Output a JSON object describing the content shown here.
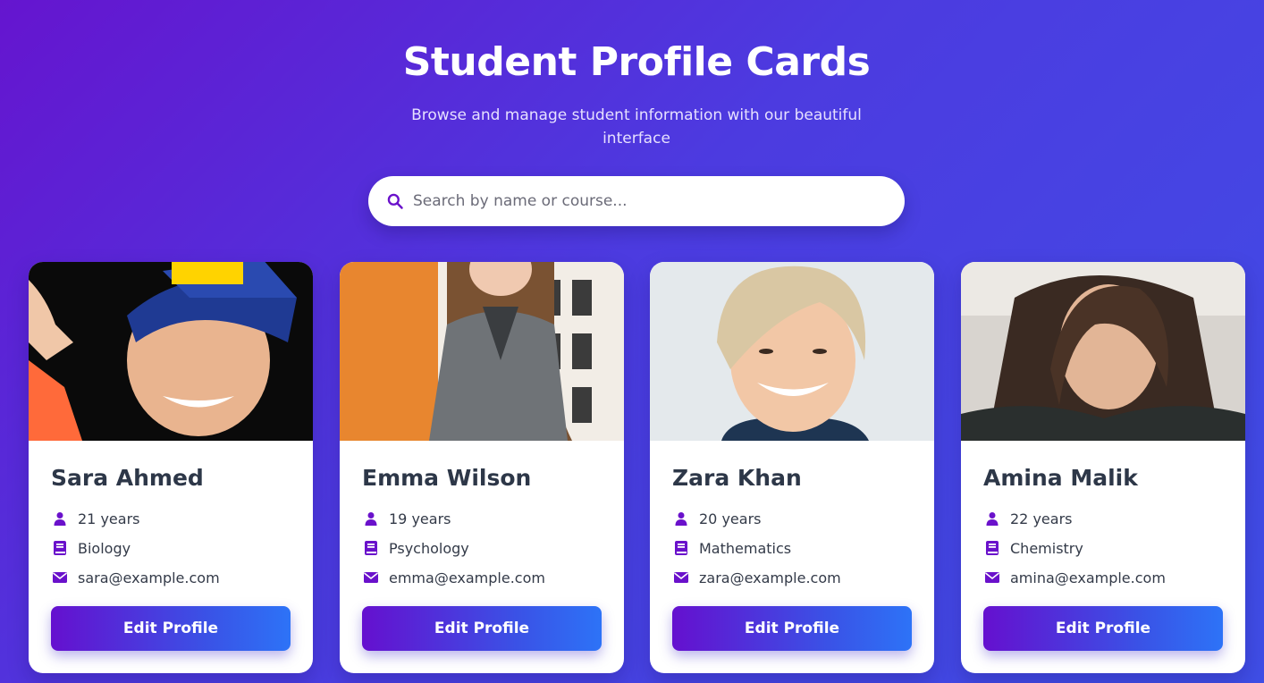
{
  "header": {
    "title": "Student Profile Cards",
    "subtitle": "Browse and manage student information with our beautiful interface"
  },
  "search": {
    "placeholder": "Search by name or course...",
    "value": ""
  },
  "colors": {
    "accent": "#6a11cb",
    "button_start": "#6510cf",
    "button_end": "#2d73f7"
  },
  "students": [
    {
      "name": "Sara Ahmed",
      "age": "21 years",
      "course": "Biology",
      "email": "sara@example.com",
      "button": "Edit Profile"
    },
    {
      "name": "Emma Wilson",
      "age": "19 years",
      "course": "Psychology",
      "email": "emma@example.com",
      "button": "Edit Profile"
    },
    {
      "name": "Zara Khan",
      "age": "20 years",
      "course": "Mathematics",
      "email": "zara@example.com",
      "button": "Edit Profile"
    },
    {
      "name": "Amina Malik",
      "age": "22 years",
      "course": "Chemistry",
      "email": "amina@example.com",
      "button": "Edit Profile"
    }
  ],
  "icons": {
    "search": "search-icon",
    "age": "user-icon",
    "course": "book-icon",
    "email": "envelope-icon"
  }
}
